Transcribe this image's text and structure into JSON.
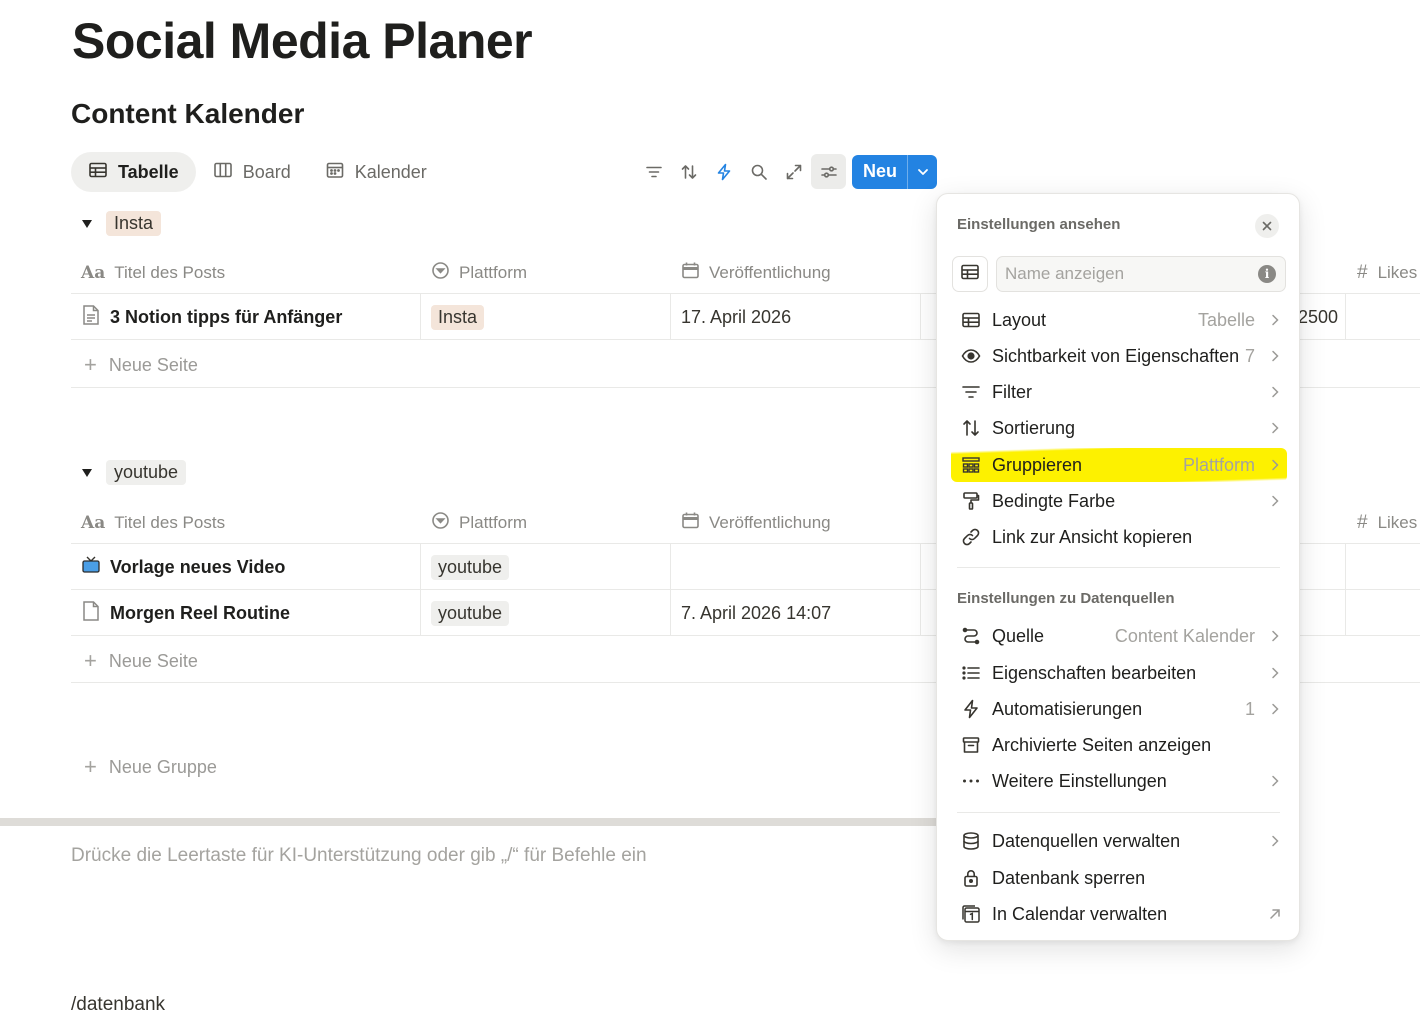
{
  "page": {
    "title": "Social Media Planer",
    "database_title": "Content Kalender",
    "hint": "Drücke die Leertaste für KI-Unterstützung oder gib „/“ für Befehle ein",
    "slash_text": "/datenbank"
  },
  "tabs": [
    {
      "label": "Tabelle",
      "icon": "table-icon",
      "active": true
    },
    {
      "label": "Board",
      "icon": "board-icon",
      "active": false
    },
    {
      "label": "Kalender",
      "icon": "calendar-icon",
      "active": false
    }
  ],
  "toolbar": {
    "icons": [
      "filter-icon",
      "sort-icon",
      "lightning-icon",
      "search-icon",
      "expand-icon",
      "settings-sliders-icon"
    ],
    "new_label": "Neu",
    "accent": "#2383e2"
  },
  "columns": {
    "title": "Titel des Posts",
    "platform": "Plattform",
    "date": "Veröffentlichung",
    "likes": "Likes"
  },
  "groups": [
    {
      "name": "Insta",
      "color": "#f4e5da",
      "rows": [
        {
          "title": "3 Notion tipps für Anfänger",
          "icon": "document-icon",
          "platform": "Insta",
          "date": "17. April 2026",
          "likes": "2500"
        }
      ],
      "new_page_label": "Neue Seite"
    },
    {
      "name": "youtube",
      "color": "#efefed",
      "rows": [
        {
          "title": "Vorlage neues Video",
          "icon": "tv-icon",
          "platform": "youtube",
          "date": "",
          "likes": ""
        },
        {
          "title": "Morgen Reel Routine",
          "icon": "page-icon",
          "platform": "youtube",
          "date": "7. April 2026 14:07",
          "likes": ""
        }
      ],
      "new_page_label": "Neue Seite"
    }
  ],
  "new_group_label": "Neue Gruppe",
  "settings_panel": {
    "title": "Einstellungen ansehen",
    "name_placeholder": "Name anzeigen",
    "items": [
      {
        "label": "Layout",
        "value": "Tabelle",
        "icon": "table-icon"
      },
      {
        "label": "Sichtbarkeit von Eigenschaften",
        "value": "7",
        "icon": "eye-icon"
      },
      {
        "label": "Filter",
        "value": "",
        "icon": "filter-icon"
      },
      {
        "label": "Sortierung",
        "value": "",
        "icon": "sort-icon"
      },
      {
        "label": "Gruppieren",
        "value": "Plattform",
        "icon": "group-icon",
        "highlight": "#fdf100"
      },
      {
        "label": "Bedingte Farbe",
        "value": "",
        "icon": "paint-roller-icon"
      },
      {
        "label": "Link zur Ansicht kopieren",
        "value": "",
        "icon": "link-icon"
      }
    ],
    "section_datasources": "Einstellungen zu Datenquellen",
    "datasource_items": [
      {
        "label": "Quelle",
        "value": "Content Kalender",
        "icon": "source-icon"
      },
      {
        "label": "Eigenschaften bearbeiten",
        "value": "",
        "icon": "list-icon"
      },
      {
        "label": "Automatisierungen",
        "value": "1",
        "icon": "lightning-icon"
      },
      {
        "label": "Archivierte Seiten anzeigen",
        "value": "",
        "icon": "archive-icon"
      },
      {
        "label": "Weitere Einstellungen",
        "value": "",
        "icon": "more-icon"
      }
    ],
    "bottom_items": [
      {
        "label": "Datenquellen verwalten",
        "icon": "database-icon"
      },
      {
        "label": "Datenbank sperren",
        "icon": "lock-icon"
      },
      {
        "label": "In Calendar verwalten",
        "icon": "calendar-app-icon"
      }
    ]
  }
}
